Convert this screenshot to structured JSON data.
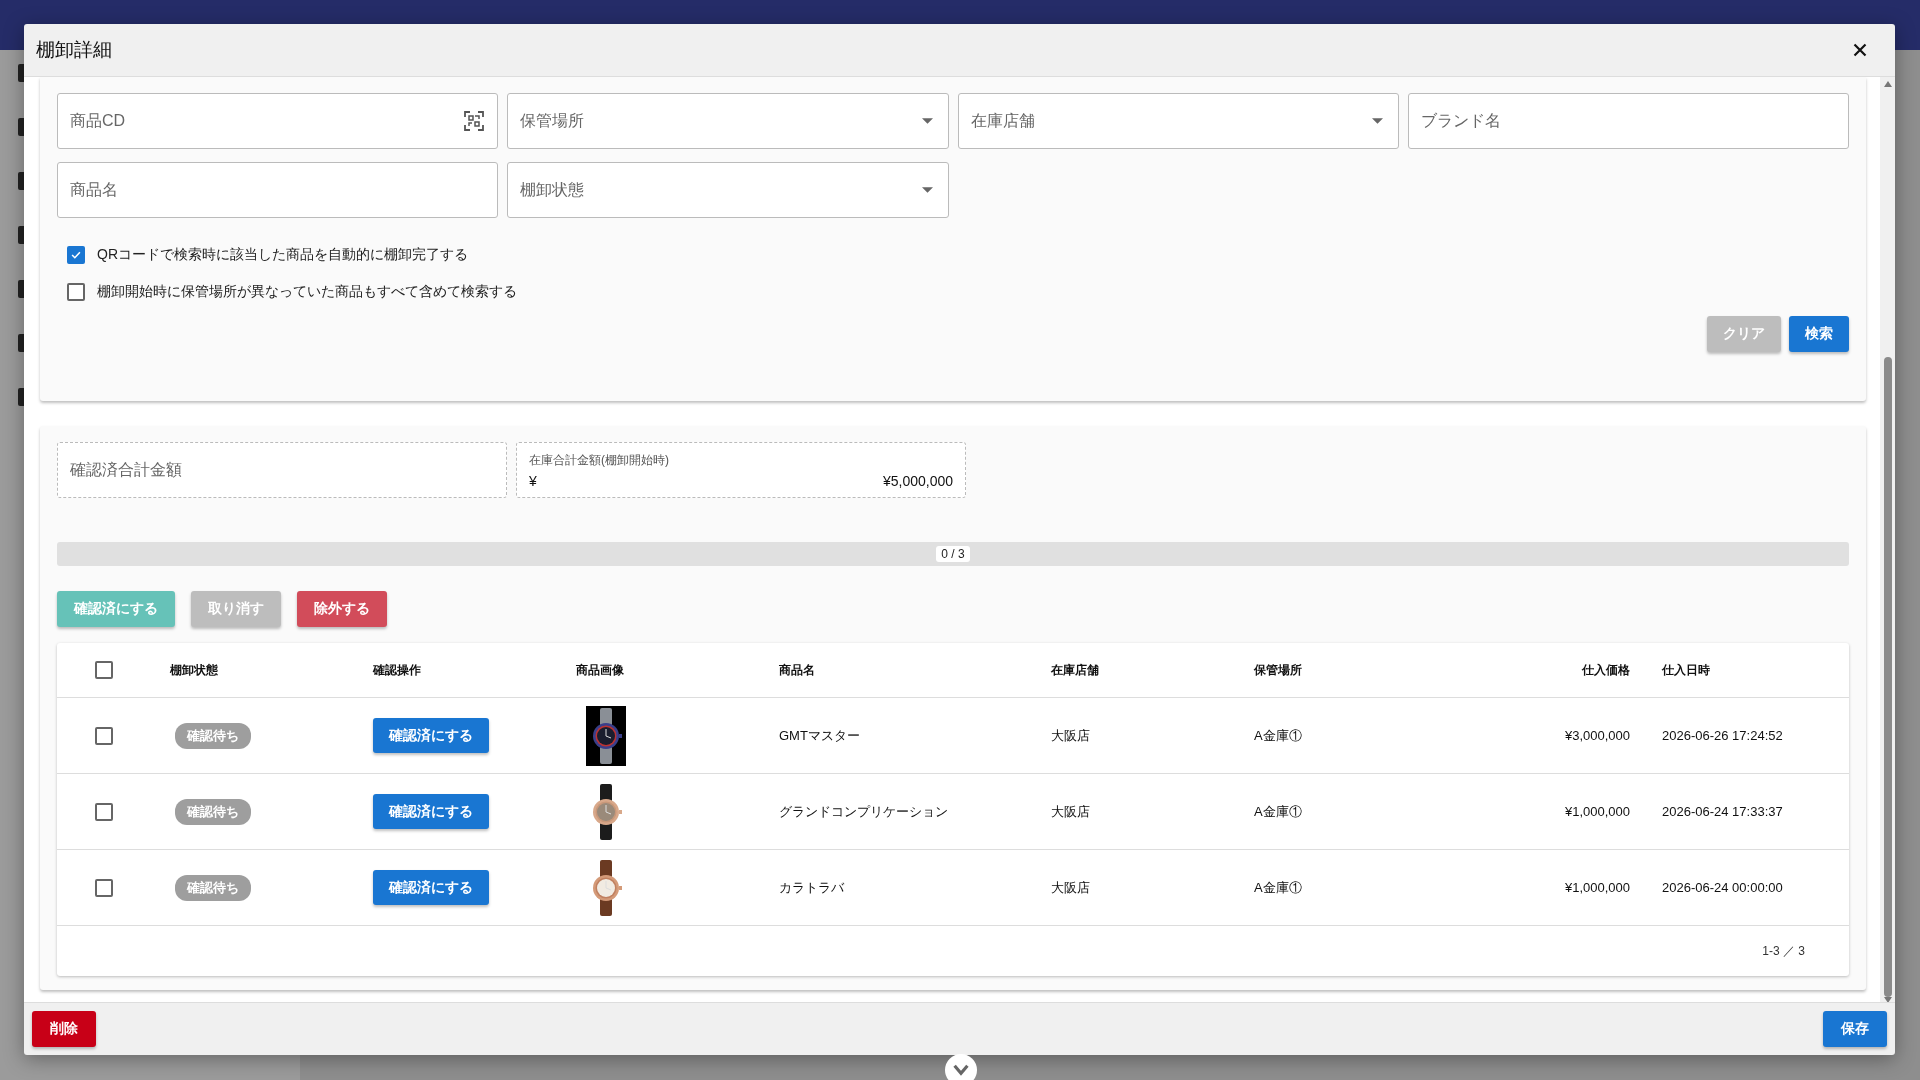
{
  "dialog": {
    "title": "棚卸詳細"
  },
  "filters": [
    {
      "kind": "scan",
      "placeholder": "商品CD"
    },
    {
      "kind": "select",
      "placeholder": "保管場所"
    },
    {
      "kind": "select",
      "placeholder": "在庫店舗"
    },
    {
      "kind": "text",
      "placeholder": "ブランド名"
    },
    {
      "kind": "text",
      "placeholder": "商品名"
    },
    {
      "kind": "select",
      "placeholder": "棚卸状態"
    }
  ],
  "options": [
    {
      "label": "QRコードで検索時に該当した商品を自動的に棚卸完了する",
      "checked": true
    },
    {
      "label": "棚卸開始時に保管場所が異なっていた商品もすべて含めて検索する",
      "checked": false
    }
  ],
  "search_buttons": [
    {
      "label": "クリア",
      "kind": "clear"
    },
    {
      "label": "検索",
      "kind": "primary"
    }
  ],
  "totals": [
    {
      "placeholder": "確認済合計金額"
    },
    {
      "label": "在庫合計金額(棚卸開始時)",
      "prefix": "¥",
      "value": "¥5,000,000"
    }
  ],
  "progress": {
    "level": 0,
    "text": "0 / 3"
  },
  "actions": [
    {
      "label": "確認済にする",
      "kind": "confirm"
    },
    {
      "label": "取り消す",
      "kind": "cancel"
    },
    {
      "label": "除外する",
      "kind": "exclude"
    }
  ],
  "table": {
    "all_selected": false,
    "columns": [
      "棚卸状態",
      "確認操作",
      "商品画像",
      "商品名",
      "在庫店舗",
      "保管場所",
      "仕入価格",
      "仕入日時"
    ],
    "rows": [
      {
        "selected": false,
        "status": "確認待ち",
        "action": "確認済にする",
        "name": "GMTマスター",
        "store": "大阪店",
        "location": "A金庫①",
        "price": "¥3,000,000",
        "date": "2026-06-26 17:24:52"
      },
      {
        "selected": false,
        "status": "確認待ち",
        "action": "確認済にする",
        "name": "グランドコンプリケーション",
        "store": "大阪店",
        "location": "A金庫①",
        "price": "¥1,000,000",
        "date": "2026-06-24 17:33:37"
      },
      {
        "selected": false,
        "status": "確認待ち",
        "action": "確認済にする",
        "name": "カラトラバ",
        "store": "大阪店",
        "location": "A金庫①",
        "price": "¥1,000,000",
        "date": "2026-06-24 00:00:00"
      }
    ],
    "pagination": "1-3 ／ 3"
  },
  "footer_buttons": [
    {
      "label": "削除",
      "kind": "delete"
    },
    {
      "label": "保存",
      "kind": "save"
    }
  ]
}
